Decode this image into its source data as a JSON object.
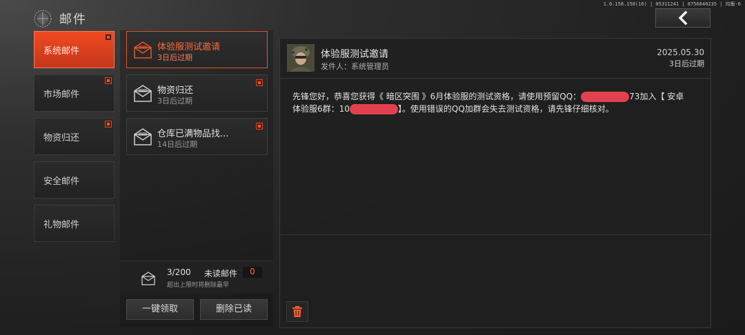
{
  "header": {
    "title": "邮件",
    "build_info": "1.0.158.158(16) | 05311241 | 8756840235 | 均衡-6"
  },
  "categories": [
    {
      "label": "系统邮件",
      "active": true,
      "unread": true
    },
    {
      "label": "市场邮件",
      "active": false,
      "unread": true
    },
    {
      "label": "物资归还",
      "active": false,
      "unread": true
    },
    {
      "label": "安全邮件",
      "active": false,
      "unread": false
    },
    {
      "label": "礼物邮件",
      "active": false,
      "unread": false
    }
  ],
  "mails": [
    {
      "title": "体验服测试邀请",
      "expire": "3日后过期",
      "active": true
    },
    {
      "title": "物资归还",
      "expire": "3日后过期",
      "active": false
    },
    {
      "title": "仓库已满物品找...",
      "expire": "14日后过期",
      "active": false
    }
  ],
  "counter": {
    "count": "3/200",
    "unread_label": "未读邮件",
    "unread_value": "0",
    "hint": "超出上限时将删除最早"
  },
  "buttons": {
    "claim_all": "一键领取",
    "delete_read": "删除已读"
  },
  "detail": {
    "title": "体验服测试邀请",
    "sender": "发件人：系统管理员",
    "date": "2025.05.30",
    "expire": "3日后过期",
    "body_line1_a": "先锋您好，恭喜您获得《 暗区突围 》6月体验服的测试资格，请使用预留QQ：",
    "body_line1_b": "73加入【 安卓",
    "body_line2_a": "体验服6群：10",
    "body_line2_b": "】。使用错误的QQ加群会失去测试资格，请先锋仔细核对。"
  },
  "colors": {
    "accent": "#e8542a",
    "redaction": "#e1414f"
  }
}
